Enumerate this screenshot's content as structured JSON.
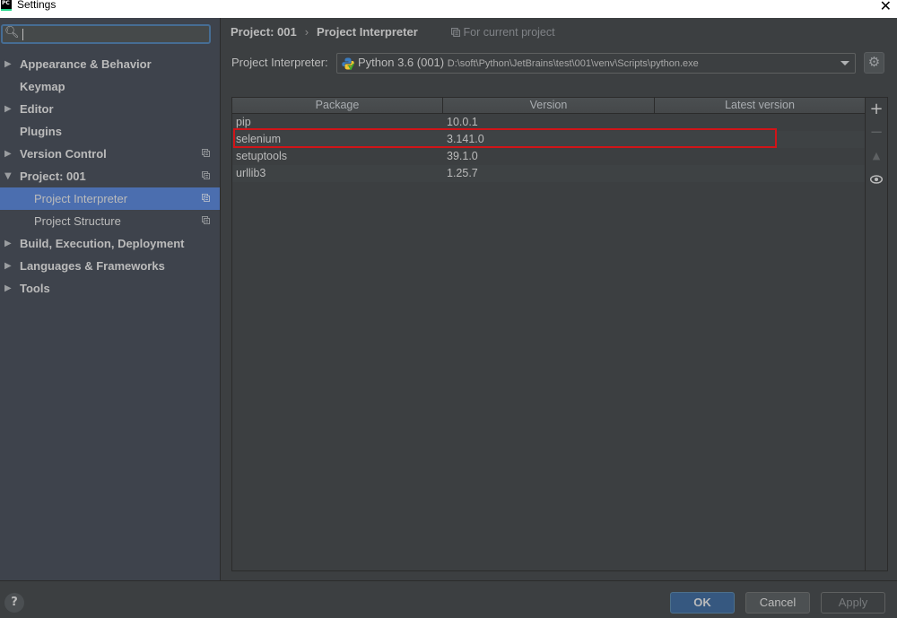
{
  "window": {
    "title": "Settings",
    "app_icon_text": "PC",
    "close_glyph": "✕"
  },
  "sidebar": {
    "search": {
      "placeholder": "",
      "value": ""
    },
    "items": [
      {
        "label": "Appearance & Behavior",
        "expandable": true,
        "expanded": false,
        "level": 0,
        "project_scoped": false
      },
      {
        "label": "Keymap",
        "expandable": false,
        "level": 0,
        "project_scoped": false
      },
      {
        "label": "Editor",
        "expandable": true,
        "expanded": false,
        "level": 0,
        "project_scoped": false
      },
      {
        "label": "Plugins",
        "expandable": false,
        "level": 0,
        "project_scoped": false
      },
      {
        "label": "Version Control",
        "expandable": true,
        "expanded": false,
        "level": 0,
        "project_scoped": true
      },
      {
        "label": "Project: 001",
        "expandable": true,
        "expanded": true,
        "level": 0,
        "project_scoped": true
      },
      {
        "label": "Project Interpreter",
        "expandable": false,
        "level": 1,
        "project_scoped": true,
        "selected": true
      },
      {
        "label": "Project Structure",
        "expandable": false,
        "level": 1,
        "project_scoped": true
      },
      {
        "label": "Build, Execution, Deployment",
        "expandable": true,
        "expanded": false,
        "level": 0,
        "project_scoped": false
      },
      {
        "label": "Languages & Frameworks",
        "expandable": true,
        "expanded": false,
        "level": 0,
        "project_scoped": false
      },
      {
        "label": "Tools",
        "expandable": true,
        "expanded": false,
        "level": 0,
        "project_scoped": false
      }
    ]
  },
  "main": {
    "breadcrumb": [
      "Project: 001",
      "Project Interpreter"
    ],
    "breadcrumb_separator": "›",
    "scope_note": "For current project",
    "interpreter": {
      "label": "Project Interpreter:",
      "name": "Python 3.6 (001)",
      "path": "D:\\soft\\Python\\JetBrains\\test\\001\\venv\\Scripts\\python.exe"
    },
    "packages_table": {
      "columns": [
        "Package",
        "Version",
        "Latest version"
      ],
      "rows": [
        {
          "package": "pip",
          "version": "10.0.1",
          "latest": ""
        },
        {
          "package": "selenium",
          "version": "3.141.0",
          "latest": "",
          "highlighted": true
        },
        {
          "package": "setuptools",
          "version": "39.1.0",
          "latest": ""
        },
        {
          "package": "urllib3",
          "version": "1.25.7",
          "latest": ""
        }
      ]
    },
    "toolbar": {
      "add": "+",
      "remove": "−",
      "upgrade": "▲",
      "show_early_releases": "👁"
    }
  },
  "footer": {
    "help": "?",
    "ok": "OK",
    "cancel": "Cancel",
    "apply": "Apply"
  },
  "colors": {
    "selection": "#4b6eaf",
    "highlight_border": "#d11418",
    "ok_button": "#365880",
    "background": "#3c3f41",
    "sidebar_background": "#3e434c"
  }
}
